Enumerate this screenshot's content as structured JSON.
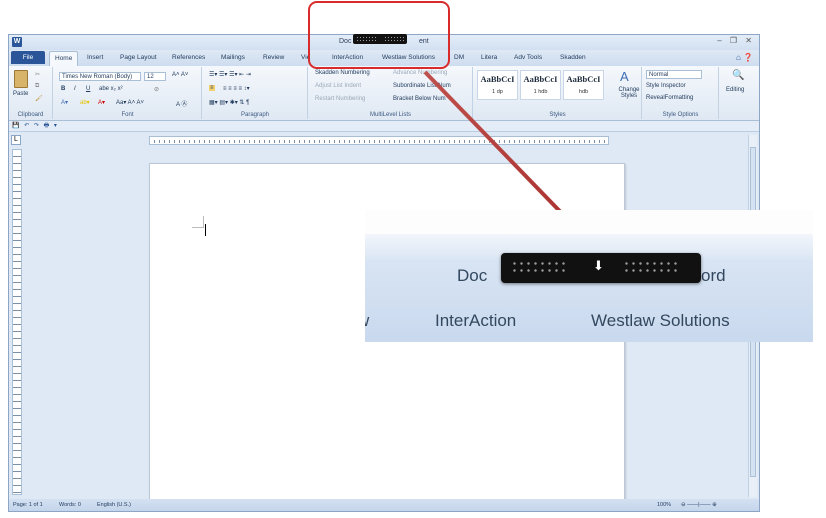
{
  "window": {
    "app_icon": "W",
    "title_left": "Doc",
    "title_right": "ent",
    "controls": "‒ ❐ ✕"
  },
  "tabs": [
    {
      "label": "File"
    },
    {
      "label": "Home"
    },
    {
      "label": "Insert"
    },
    {
      "label": "Page Layout"
    },
    {
      "label": "References"
    },
    {
      "label": "Mailings"
    },
    {
      "label": "Review"
    },
    {
      "label": "Vie"
    },
    {
      "label": "InterAction"
    },
    {
      "label": "Westlaw Solutions"
    },
    {
      "label": "DM"
    },
    {
      "label": "Litera"
    },
    {
      "label": "Adv Tools"
    },
    {
      "label": "Skadden"
    }
  ],
  "ribbon": {
    "clipboard": {
      "paste_label": "Paste",
      "group_label": "Clipboard"
    },
    "font": {
      "font_name": "Times New Roman (Body)",
      "font_size": "12",
      "bold": "B",
      "italic": "I",
      "underline": "U",
      "group_label": "Font"
    },
    "paragraph": {
      "group_label": "Paragraph"
    },
    "multilevel": {
      "skadden_numbering": "Skadden Numbering",
      "advance_numbering": "Advance Numbering",
      "adjust_list_indent": "Adjust List Indent",
      "subordinate_list_num": "Subordinate List Num",
      "restart_numbering": "Restart Numbering",
      "bracket_below_num": "Bracket Below Num",
      "group_label": "MultiLevel Lists"
    },
    "styles": {
      "tiles": [
        {
          "sample": "AaBbCcI",
          "name": "1 dp"
        },
        {
          "sample": "AaBbCcI",
          "name": "1 hdb"
        },
        {
          "sample": "AaBbCcI",
          "name": "hdb"
        }
      ],
      "change_styles": "Change Styles",
      "group_label": "Styles"
    },
    "style_options": {
      "current_style": "Normal",
      "style_inspector": "Style Inspector",
      "reveal_formatting": "RevealFormatting",
      "group_label": "Style Options"
    },
    "editing": {
      "label": "Editing"
    }
  },
  "statusbar": {
    "page": "Page: 1 of 1",
    "words": "Words: 0",
    "language": "English (U.S.)",
    "zoom": "100%"
  },
  "zoom_panel": {
    "title_left": "Doc",
    "title_right": "ord",
    "tab_partial": "w",
    "tab_interaction": "InterAction",
    "tab_westlaw": "Westlaw Solutions"
  },
  "colors": {
    "highlight": "#d92b2b",
    "file_tab": "#2a5699",
    "ribbon_bg": "#dfe9f5"
  }
}
